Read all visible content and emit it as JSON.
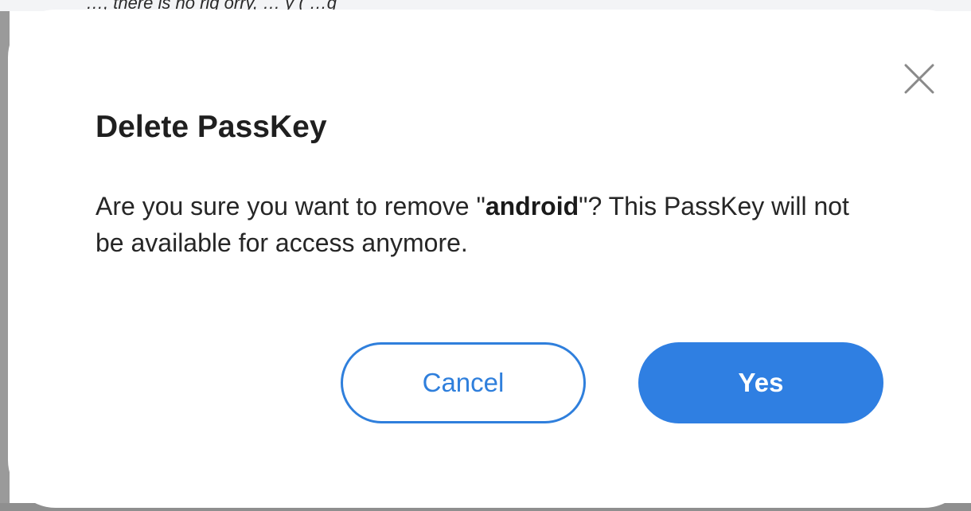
{
  "background": {
    "partial_text": "…, there is no rig     orry, … y  ( …g"
  },
  "dialog": {
    "title": "Delete PassKey",
    "message_before": "Are you sure you want to remove \"",
    "passkey_name": "android",
    "message_after": "\"? This PassKey will not be available for access anymore.",
    "close_icon": "close-icon",
    "cancel_label": "Cancel",
    "yes_label": "Yes"
  },
  "colors": {
    "accent": "#2f7fe2",
    "title_text": "#1f1f1f",
    "body_text": "#262626"
  }
}
